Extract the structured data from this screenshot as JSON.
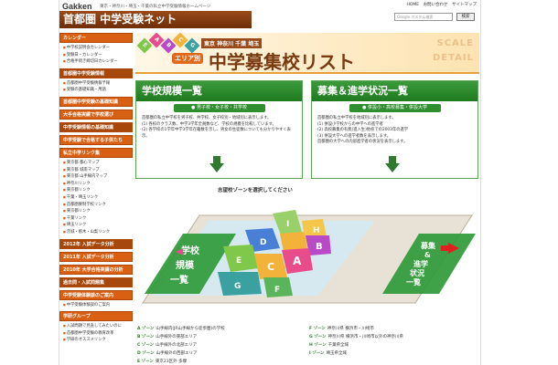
{
  "header": {
    "logo": "Gakken",
    "tagline": "東京・神奈川・埼玉・千葉の私立中学受験情報ホームページ",
    "site_title": "首都圏 中学受験ネット",
    "links": [
      "HOME",
      "お問い合わせ",
      "サイトマップ"
    ],
    "search_placeholder": "Google カスタム検索",
    "search_button": "検索"
  },
  "sidebar": {
    "blocks": [
      {
        "title": "カレンダー",
        "links": [
          "中学校説明会カレンダー",
          "受験日・カレンダー",
          "合格手続き締切日カレンダー"
        ]
      },
      {
        "title": "首都圏中学受験情報",
        "links": [
          "首都圏中学受験情報予報",
          "受験の基礎知識・用語"
        ]
      },
      {
        "title": "首都圏中学受験の基礎知識",
        "links": []
      },
      {
        "title": "大手合格実績で学校選び",
        "links": []
      },
      {
        "title": "中学受験情報の基礎知識",
        "links": []
      },
      {
        "title": "中学受験で合格する子供たち",
        "links": []
      },
      {
        "title": "私立中学リンク集",
        "links": [
          "東京都 都心マップ",
          "東京都 城南マップ",
          "東京都 山手線内マップ",
          "神奈川リンク",
          "東京都リンク",
          "千葉・埼玉リンク",
          "首都圏寮制学校リンク",
          "東京都リンク",
          "千葉リンク",
          "埼玉リンク",
          "茨城・栃木・山梨リンク"
        ]
      },
      {
        "title": "2012年 入試データ分析",
        "links": []
      },
      {
        "title": "2011年 入試データ分析",
        "links": []
      },
      {
        "title": "2010年 大学合格実績の分析",
        "links": []
      },
      {
        "title": "過去問・入試問題集",
        "links": []
      },
      {
        "title": "中学受験体験談のご案内",
        "links": [
          "中学受験体験談のご案内"
        ]
      },
      {
        "title": "学研グループ",
        "links": [
          "入試問題で見直してみたいのに",
          "首都圏中学受験の教育改革",
          "学研のオススメリンク"
        ]
      }
    ]
  },
  "banner": {
    "chips": [
      "E",
      "A",
      "B",
      "C",
      "G"
    ],
    "prefectures": "東京 神奈川 千葉 埼玉",
    "area_tag": "エリア別",
    "title": "中学募集校リスト",
    "scale": "SCALE",
    "detail": "DETAIL"
  },
  "cards": [
    {
      "title": "学校規模一覧",
      "sub": "● 男子校・女子校・共学校",
      "lines": [
        "首都圏の私立中学校を男子校、共学校、女子校別・地域別に表示します。",
        "(1) 各校のクラス数、中学3学年全員数など、学校の規模を比較しています。",
        "(2) 各学校の1学年中学3学年在籍数を示し、男女の生徒数についても分かりやすく表示。"
      ]
    },
    {
      "title": "募集＆進学状況一覧",
      "sub": "● 併設小・高校募集・併設大学",
      "lines": [
        "首都圏の私立中学校を地域別に表示します。",
        "(1) 併設小学校からの中学への進学者",
        "(2) 高校募集の有無(進入生)他校での2003年の進学",
        "(3) 併設大学への進学者数を表示します。",
        "首都圏の大学への内部進学者の状況を表示します。"
      ]
    }
  ],
  "map": {
    "zone_prompt": "志望校ゾーンを選択してください",
    "left_label": [
      "学校",
      "規模",
      "一覧"
    ],
    "right_label": [
      "募集",
      "&",
      "進学",
      "状況",
      "一覧"
    ],
    "zones": [
      "A",
      "B",
      "C",
      "D",
      "E",
      "F",
      "G",
      "H",
      "I"
    ]
  },
  "footer": {
    "left": [
      {
        "key": "A ゾーン",
        "text": "山手線内(JR山手線から徒歩圏)の学校"
      },
      {
        "key": "B ゾーン",
        "text": "山手線外の東部エリア"
      },
      {
        "key": "C ゾーン",
        "text": "山手線外の北部エリア"
      },
      {
        "key": "D ゾーン",
        "text": "山手線外の西部エリア"
      },
      {
        "key": "E ゾーン",
        "text": "東京23区外 多摩"
      }
    ],
    "right": [
      {
        "key": "F ゾーン",
        "text": "神奈川県 横浜市・川崎市"
      },
      {
        "key": "G ゾーン",
        "text": "神奈川県 横浜市・川崎市以外の神奈川県"
      },
      {
        "key": "H ゾーン",
        "text": "千葉県全域"
      },
      {
        "key": "I ゾーン",
        "text": "埼玉県全域"
      }
    ]
  },
  "colors": {
    "accent": "#d95f12",
    "brand_dark": "#7a3a10",
    "green": "#2f8f2f",
    "zone_A": "#e94c8a",
    "zone_B": "#b84ac8",
    "zone_C": "#f3b33a",
    "zone_D": "#4a7fd8",
    "zone_E": "#7fc84a",
    "zone_F": "#5ab55a",
    "zone_G": "#3aa0a0",
    "zone_H": "#f5c64a",
    "zone_I": "#9ad06a"
  }
}
